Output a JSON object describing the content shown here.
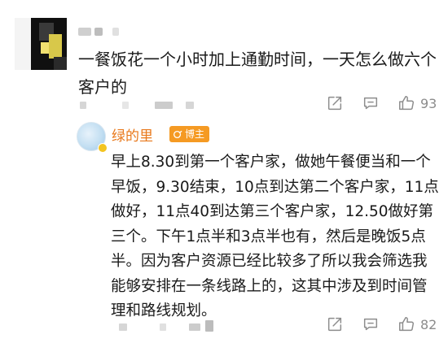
{
  "comment": {
    "text": "一餐饭花一个小时加上通勤时间，一天怎么做六个客户的",
    "actions": {
      "like_count": "93"
    }
  },
  "reply": {
    "author": "绿的里",
    "badge_label": "博主",
    "text": "早上8.30到第一个客户家，做她午餐便当和一个早饭，9.30结束，10点到达第二个客户家，11点做好，11点40到达第三个客户家，12.50做好第三个。下午1点半和3点半也有，然后是晚饭5点半。因为客户资源已经比较多了所以我会筛选我能够安排在一条线路上的，这其中涉及到时间管理和路线规划。",
    "actions": {
      "like_count": "82"
    }
  },
  "colors": {
    "author_name": "#e8781a",
    "badge_bg": "#f59a23",
    "icon_gray": "#8c8c8c"
  }
}
